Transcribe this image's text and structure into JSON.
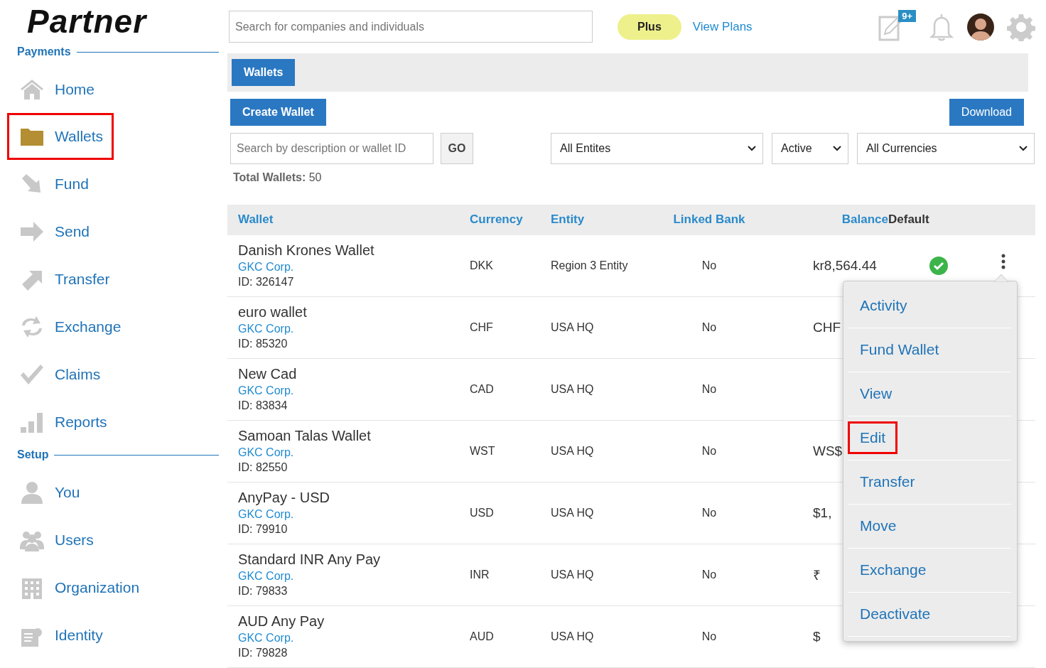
{
  "logo": {
    "text": "Partner"
  },
  "header": {
    "search_placeholder": "Search for companies and individuals",
    "plan_badge": "Plus",
    "plans_link": "View Plans",
    "notes_badge": "9+"
  },
  "sidebar": {
    "sections": [
      {
        "title": "Payments",
        "items": [
          {
            "label": "Home",
            "selected": false,
            "highlighted": false
          },
          {
            "label": "Wallets",
            "selected": true,
            "highlighted": true
          },
          {
            "label": "Fund",
            "selected": false,
            "highlighted": false
          },
          {
            "label": "Send",
            "selected": false,
            "highlighted": false
          },
          {
            "label": "Transfer",
            "selected": false,
            "highlighted": false
          },
          {
            "label": "Exchange",
            "selected": false,
            "highlighted": false
          },
          {
            "label": "Claims",
            "selected": false,
            "highlighted": false
          },
          {
            "label": "Reports",
            "selected": false,
            "highlighted": false
          }
        ]
      },
      {
        "title": "Setup",
        "items": [
          {
            "label": "You",
            "selected": false,
            "highlighted": false
          },
          {
            "label": "Users",
            "selected": false,
            "highlighted": false
          },
          {
            "label": "Organization",
            "selected": false,
            "highlighted": false
          },
          {
            "label": "Identity",
            "selected": false,
            "highlighted": false
          }
        ]
      }
    ]
  },
  "tabs": [
    {
      "label": "Wallets",
      "selected": true
    }
  ],
  "actions": {
    "create": "Create Wallet",
    "download": "Download"
  },
  "filters": {
    "search_placeholder": "Search by description or wallet ID",
    "go": "GO",
    "entity": "All Entites",
    "status": "Active",
    "currency": "All Currencies"
  },
  "total": "**Total Wallets:** 50",
  "table": {
    "columns": [
      "Wallet",
      "Currency",
      "Entity",
      "Linked Bank",
      "Balance",
      "Default"
    ],
    "rows": [
      {
        "name": "Danish Krones Wallet",
        "company": "GKC Corp.",
        "id": "ID: 326147",
        "currency": "DKK",
        "entity": "Region 3 Entity",
        "linked_bank": "No",
        "balance": "kr8,564.44",
        "default": true,
        "menu_open": true
      },
      {
        "name": "euro wallet",
        "company": "GKC Corp.",
        "id": "ID: 85320",
        "currency": "CHF",
        "entity": "USA HQ",
        "linked_bank": "No",
        "balance": "CHF",
        "default": false,
        "menu_open": false
      },
      {
        "name": "New Cad",
        "company": "GKC Corp.",
        "id": "ID: 83834",
        "currency": "CAD",
        "entity": "USA HQ",
        "linked_bank": "No",
        "default": false,
        "menu_open": false
      },
      {
        "name": "Samoan Talas Wallet",
        "company": "GKC Corp.",
        "id": "ID: 82550",
        "currency": "WST",
        "entity": "USA HQ",
        "linked_bank": "No",
        "balance": "WS$",
        "default": false,
        "menu_open": false
      },
      {
        "name": "AnyPay - USD",
        "company": "GKC Corp.",
        "id": "ID: 79910",
        "currency": "USD",
        "entity": "USA HQ",
        "linked_bank": "No",
        "balance": "$1,",
        "default": false,
        "menu_open": false
      },
      {
        "name": "Standard INR Any Pay",
        "company": "GKC Corp.",
        "id": "ID: 79833",
        "currency": "INR",
        "entity": "USA HQ",
        "linked_bank": "No",
        "balance": "₹",
        "default": false,
        "menu_open": false
      },
      {
        "name": "AUD Any Pay",
        "company": "GKC Corp.",
        "id": "ID: 79828",
        "currency": "AUD",
        "entity": "USA HQ",
        "linked_bank": "No",
        "balance": "$",
        "default": false,
        "menu_open": false
      }
    ]
  },
  "row_menu": {
    "items": [
      {
        "label": "Activity",
        "highlighted": false
      },
      {
        "label": "Fund Wallet",
        "highlighted": false
      },
      {
        "label": "View",
        "highlighted": false
      },
      {
        "label": "Edit",
        "highlighted": true
      },
      {
        "label": "Transfer",
        "highlighted": false
      },
      {
        "label": "Move",
        "highlighted": false
      },
      {
        "label": "Exchange",
        "highlighted": false
      },
      {
        "label": "Deactivate",
        "highlighted": false
      }
    ]
  }
}
